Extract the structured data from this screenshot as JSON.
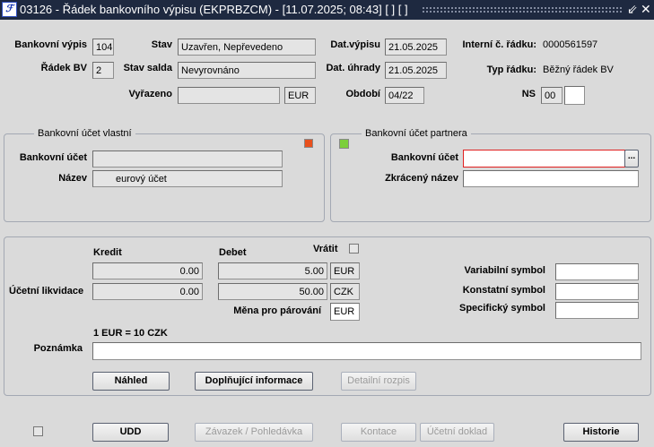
{
  "window": {
    "title": "03126 - Řádek bankovního výpisu (EKPRBZCM) - [11.07.2025; 08:43]  [ ]  [ ]",
    "logo": "IF"
  },
  "header": {
    "bankovni_vypis": {
      "label": "Bankovní výpis",
      "value": "104"
    },
    "radek_bv": {
      "label": "Řádek BV",
      "value": "2"
    },
    "stav": {
      "label": "Stav",
      "value": "Uzavřen, Nepřevedeno"
    },
    "stav_salda": {
      "label": "Stav salda",
      "value": "Nevyrovnáno"
    },
    "vyrazeno": {
      "label": "Vyřazeno",
      "value": "",
      "currency": "EUR"
    },
    "dat_vypisu": {
      "label": "Dat.výpisu",
      "value": "21.05.2025"
    },
    "dat_uhrady": {
      "label": "Dat. úhrady",
      "value": "21.05.2025"
    },
    "obdobi": {
      "label": "Období",
      "value": "04/22"
    },
    "interni": {
      "label": "Interní č. řádku:",
      "value": "0000561597"
    },
    "typ": {
      "label": "Typ řádku:",
      "value": "Běžný řádek BV"
    },
    "ns": {
      "label": "NS",
      "value": "00",
      "value2": ""
    }
  },
  "own_account": {
    "legend": "Bankovní účet vlastní",
    "account_label": "Bankovní účet",
    "account_value": "",
    "name_label": "Název",
    "name_value": "eurový účet",
    "indicator_color": "#e8501c"
  },
  "partner_account": {
    "legend": "Bankovní účet partnera",
    "account_label": "Bankovní účet",
    "account_value": "",
    "short_label": "Zkrácený název",
    "short_value": "",
    "lookup": "...",
    "indicator_color": "#7ccf3c"
  },
  "amounts": {
    "kredit_label": "Kredit",
    "debet_label": "Debet",
    "vratit_label": "Vrátit",
    "row_label": "Účetní likvidace",
    "kredit1": "0.00",
    "debet1": "5.00",
    "cur1": "EUR",
    "kredit2": "0.00",
    "debet2": "50.00",
    "cur2": "CZK",
    "mena_label": "Měna pro párování",
    "mena_value": "EUR",
    "rate": "1 EUR = 10 CZK",
    "var_label": "Variabilní symbol",
    "var_value": "",
    "konst_label": "Konstatní symbol",
    "konst_value": "",
    "spec_label": "Specifický symbol",
    "spec_value": "",
    "poznamka_label": "Poznámka",
    "poznamka_value": ""
  },
  "buttons": {
    "nahled": "Náhled",
    "doplnujici": "Doplňující informace",
    "detailni": "Detailní rozpis",
    "udd": "UDD",
    "zavazek": "Závazek / Pohledávka",
    "kontace": "Kontace",
    "ucetni": "Účetní doklad",
    "historie": "Historie"
  }
}
